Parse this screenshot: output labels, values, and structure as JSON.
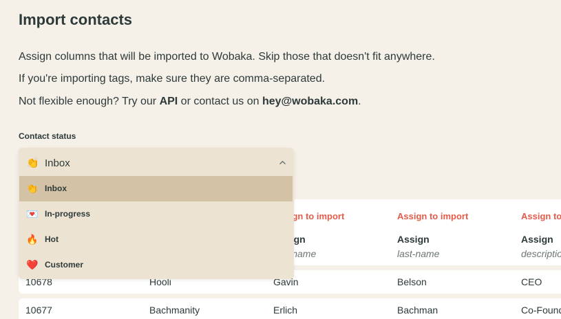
{
  "title": "Import contacts",
  "intro": {
    "line1": "Assign columns that will be imported to Wobaka. Skip those that doesn't fit anywhere.",
    "line2": "If you're importing tags, make sure they are comma-separated.",
    "line3_pre": "Not flexible enough? Try our ",
    "line3_api": "API",
    "line3_mid": " or contact us on ",
    "line3_email": "hey@wobaka.com",
    "line3_post": "."
  },
  "status_field": {
    "label": "Contact status",
    "selected": {
      "icon": "👏",
      "label": "Inbox"
    },
    "options": [
      {
        "icon": "👏",
        "label": "Inbox"
      },
      {
        "icon": "💌",
        "label": "In-progress"
      },
      {
        "icon": "🔥",
        "label": "Hot"
      },
      {
        "icon": "❤️",
        "label": "Customer"
      }
    ]
  },
  "columns": [
    {
      "assign_link": "Assign to import",
      "assign_label": "Assign",
      "field": "first-name"
    },
    {
      "assign_link": "Assign to import",
      "assign_label": "Assign",
      "field": "last-name"
    },
    {
      "assign_link": "Assign to import",
      "assign_label": "Assign",
      "field": "description"
    }
  ],
  "rows": [
    {
      "id": "10678",
      "company": "Hooli",
      "first": "Gavin",
      "last": "Belson",
      "title": "CEO"
    },
    {
      "id": "10677",
      "company": "Bachmanity",
      "first": "Erlich",
      "last": "Bachman",
      "title": "Co-Founder"
    }
  ],
  "colors": {
    "accent": "#e25c4b",
    "background": "#f5f0e8",
    "dropdown_bg": "#ede3d3",
    "selected_bg": "#d3c2a5"
  }
}
